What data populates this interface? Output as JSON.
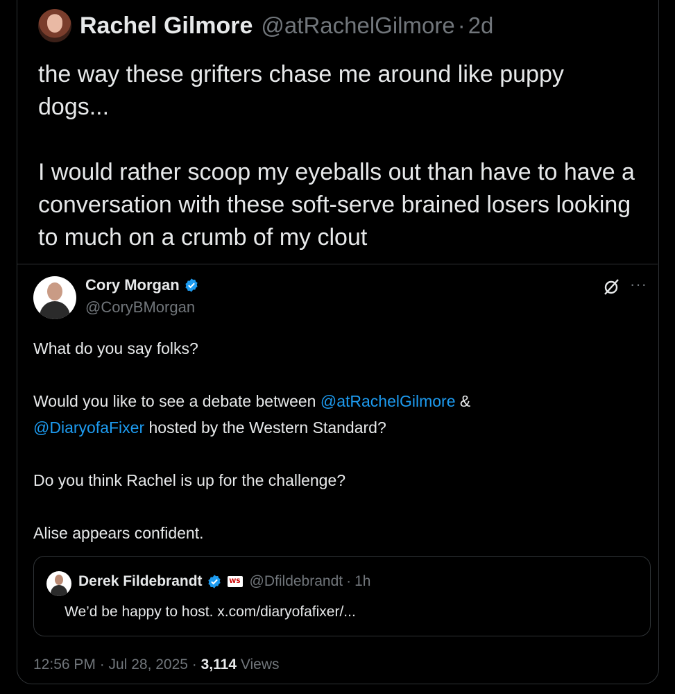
{
  "top_post": {
    "author_name": "Rachel Gilmore",
    "author_handle": "@atRachelGilmore",
    "separator": "·",
    "time_ago": "2d",
    "body": "the way these grifters chase me around like puppy dogs...\n\nI would rather scoop my eyeballs out than have to have a conversation with these soft-serve brained losers looking to much on a crumb of my clout"
  },
  "quoted_post": {
    "author_name": "Cory Morgan",
    "author_handle": "@CoryBMorgan",
    "more_icon": "···",
    "paragraph1": "What do you say folks?",
    "p2_before": "Would you like to see a debate between ",
    "p2_mention1": "@atRachelGilmore",
    "p2_amp": " &",
    "p2_mention2": "@DiaryofaFixer",
    "p2_after": " hosted by the Western Standard?",
    "paragraph3": "Do you think Rachel is up for the challenge?",
    "paragraph4": "Alise appears confident.",
    "timestamp": "12:56 PM · Jul 28, 2025 · ",
    "views_count": "3,114",
    "views_label": " Views"
  },
  "nested_quote": {
    "author_name": "Derek Fildebrandt",
    "affiliate_badge": "WS",
    "author_handle": "@Dfildebrandt",
    "separator": "·",
    "time_ago": "1h",
    "text": "We’d be happy to host. x.com/diaryofafixer/..."
  },
  "colors": {
    "background": "#000000",
    "text": "#e7e9ea",
    "muted": "#71767b",
    "link": "#1d9bf0",
    "border": "#2f3336"
  }
}
